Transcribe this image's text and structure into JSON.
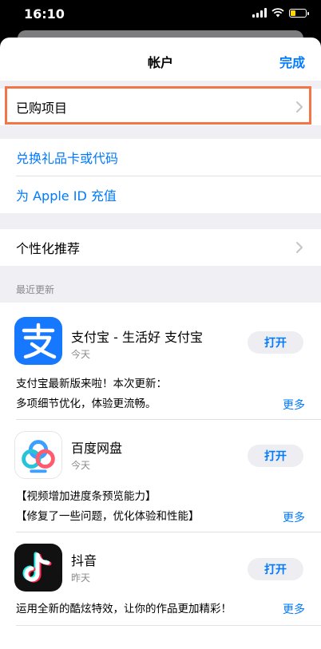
{
  "status": {
    "time": "16:10"
  },
  "nav": {
    "title": "帐户",
    "done": "完成"
  },
  "rows": {
    "purchased": "已购项目",
    "redeem": "兑换礼品卡或代码",
    "topup": "为 Apple ID 充值",
    "personalized": "个性化推荐"
  },
  "updates": {
    "header": "最近更新",
    "apps": [
      {
        "name": "支付宝 - 生活好 支付宝",
        "date": "今天",
        "button": "打开",
        "notes": [
          "支付宝最新版来啦！本次更新：",
          "多项细节优化，体验更流畅。"
        ],
        "more": "更多",
        "icon": "alipay-icon"
      },
      {
        "name": "百度网盘",
        "date": "今天",
        "button": "打开",
        "notes": [
          "【视频增加进度条预览能力】",
          "【修复了一些问题，优化体验和性能】"
        ],
        "more": "更多",
        "icon": "baidu-netdisk-icon"
      },
      {
        "name": "抖音",
        "date": "昨天",
        "button": "打开",
        "notes": [
          "运用全新的酷炫特效，让你的作品更加精彩！"
        ],
        "more": "更多",
        "icon": "douyin-icon"
      }
    ]
  },
  "colors": {
    "accent": "#007aff",
    "highlight": "#f27447",
    "alipay": "#1677ff",
    "douyin": "#111111"
  }
}
